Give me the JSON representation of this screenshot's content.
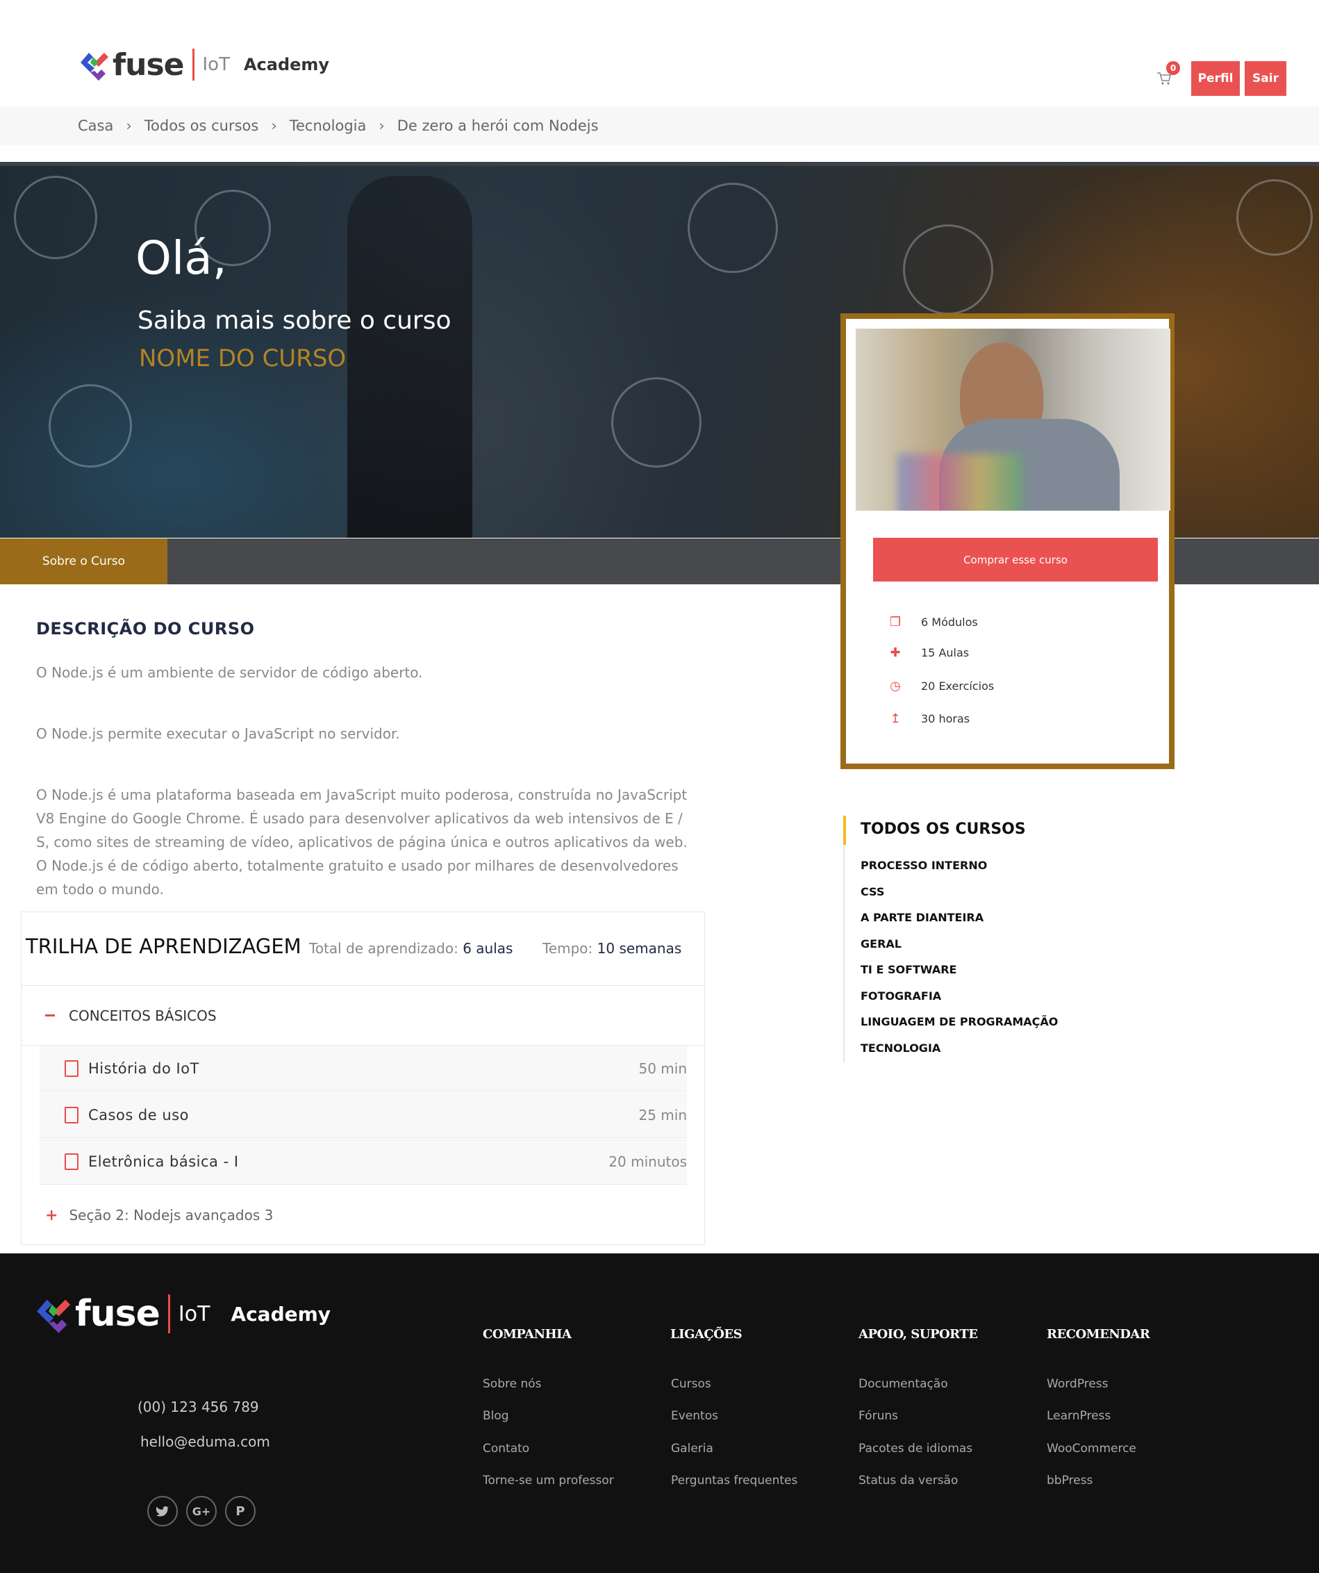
{
  "header": {
    "logo": {
      "word": "fuse",
      "iot": "IoT",
      "academy": "Academy"
    },
    "cart_count": "0",
    "profile_label": "Perfil",
    "logout_label": "Sair"
  },
  "breadcrumb": [
    "Casa",
    "Todos os cursos",
    "Tecnologia",
    "De zero a herói com Nodejs"
  ],
  "hero": {
    "greeting": "Olá,",
    "subtitle": "Saiba mais sobre o curso",
    "course_name": "NOME DO CURSO"
  },
  "tabs": {
    "active": "Sobre o Curso"
  },
  "card": {
    "buy_label": "Comprar esse curso",
    "meta": [
      {
        "icon": "copy-icon",
        "label": "6 Módulos"
      },
      {
        "icon": "puzzle-icon",
        "label": "15 Aulas"
      },
      {
        "icon": "clock-icon",
        "label": "20 Exercícios"
      },
      {
        "icon": "arrow-up-icon",
        "label": "30 horas"
      }
    ]
  },
  "description": {
    "title": "DESCRIÇÃO DO CURSO",
    "p1": "O Node.js é um ambiente de servidor de código aberto.",
    "p2": "O Node.js permite executar o JavaScript no servidor.",
    "p3": "O Node.js é uma plataforma baseada em JavaScript muito poderosa, construída no JavaScript V8 Engine do Google Chrome. É usado para desenvolver aplicativos da web intensivos de E / S, como sites de streaming de vídeo, aplicativos de página única e outros aplicativos da web. O Node.js é de código aberto, totalmente gratuito e usado por milhares de desenvolvedores em todo o mundo."
  },
  "curriculum": {
    "title": "TRILHA DE APRENDIZAGEM",
    "total_label": "Total de aprendizado:",
    "total_value": "6 aulas",
    "time_label": "Tempo:",
    "time_value": "10 semanas",
    "section1": "CONCEITOS BÁSICOS",
    "lessons": [
      {
        "title": "História do IoT",
        "time": "50 min"
      },
      {
        "title": "Casos de uso",
        "time": "25 min"
      },
      {
        "title": "Eletrônica básica - I",
        "time": "20 minutos"
      }
    ],
    "section2": "Seção 2: Nodejs avançados 3"
  },
  "sidebar": {
    "title": "TODOS OS CURSOS",
    "categories": [
      "PROCESSO INTERNO",
      "CSS",
      "A PARTE DIANTEIRA",
      "GERAL",
      "TI E SOFTWARE",
      "FOTOGRAFIA",
      "LINGUAGEM DE PROGRAMAÇÃO",
      "TECNOLOGIA"
    ]
  },
  "footer": {
    "phone": "(00) 123 456 789",
    "email": "hello@eduma.com",
    "columns": [
      {
        "title": "COMPANHIA",
        "links": [
          "Sobre nós",
          "Blog",
          "Contato",
          "Torne-se um professor"
        ]
      },
      {
        "title": "LIGAÇÕES",
        "links": [
          "Cursos",
          "Eventos",
          "Galeria",
          "Perguntas frequentes"
        ]
      },
      {
        "title": "APOIO, SUPORTE",
        "links": [
          "Documentação",
          "Fóruns",
          "Pacotes de idiomas",
          "Status da versão"
        ]
      },
      {
        "title": "RECOMENDAR",
        "links": [
          "WordPress",
          "LearnPress",
          "WooCommerce",
          "bbPress"
        ]
      }
    ],
    "social": [
      {
        "icon": "twitter-icon",
        "glyph": "🐦"
      },
      {
        "icon": "google-plus-icon",
        "glyph": "G+"
      },
      {
        "icon": "pinterest-icon",
        "glyph": "P"
      }
    ]
  },
  "colors": {
    "accent": "#ea5252",
    "gold": "#9a6c19",
    "footer_bg": "#111111"
  }
}
